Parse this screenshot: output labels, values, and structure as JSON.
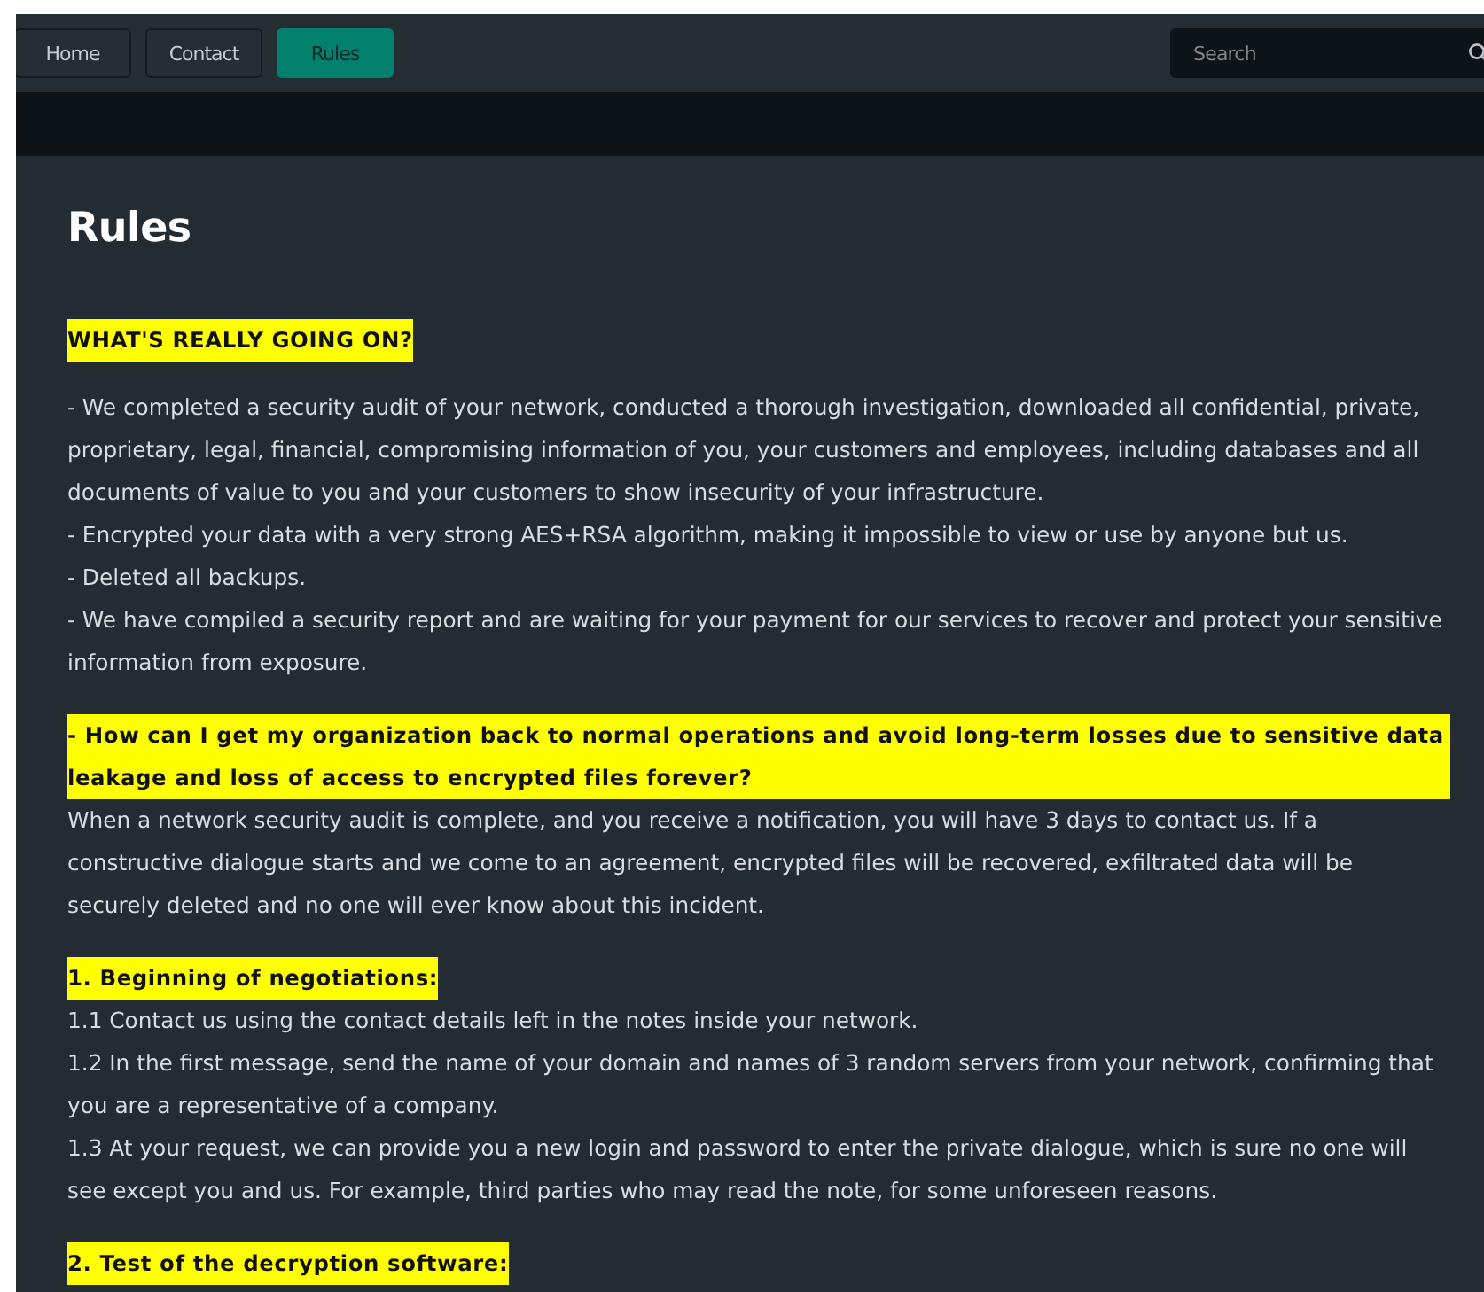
{
  "nav": {
    "tabs": [
      {
        "label": "Home",
        "selected": false
      },
      {
        "label": "Contact",
        "selected": false
      },
      {
        "label": "Rules",
        "selected": true
      }
    ],
    "search": {
      "placeholder": "Search"
    }
  },
  "title": "Rules",
  "sections": [
    {
      "heading": "WHAT'S REALLY GOING ON?",
      "lines": [
        "- We completed a security audit of your network, conducted a thorough investigation, downloaded all confidential, private, proprietary, legal, financial, compromising information of you, your customers and employees, including databases and all documents of value to you and your customers to show insecurity of your infrastructure.",
        "- Encrypted your data with a very strong AES+RSA algorithm, making it impossible to view or use by anyone but us.",
        "- Deleted all backups.",
        "- We have compiled a security report and are waiting for your payment for our services to recover and protect your sensitive information from exposure."
      ]
    },
    {
      "heading": "- How can I get my organization back to normal operations and avoid long-term losses due to sensitive data leakage and loss of access to encrypted files forever?",
      "lines": [
        "When a network security audit is complete, and you receive a notification, you will have 3 days to contact us. If a constructive dialogue starts and we come to an agreement, encrypted files will be recovered, exfiltrated data will be securely deleted and no one will ever know about this incident."
      ]
    },
    {
      "heading": "1.  Beginning of negotiations:",
      "lines": [
        "1.1 Contact us using the contact details left in the notes inside your network.",
        "1.2 In the first message, send the name of your domain and names of 3 random servers from your network, confirming that you are a representative of a company.",
        "1.3 At your request, we can provide you a new login and password to enter the private dialogue, which is sure no one will see except you and us. For example, third parties who may read the note, for some unforeseen reasons."
      ]
    },
    {
      "heading": "2. Test of the decryption software:"
    }
  ]
}
